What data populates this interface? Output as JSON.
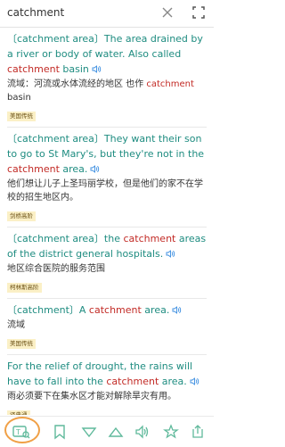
{
  "search": {
    "query": "catchment"
  },
  "entries": [
    {
      "en": [
        {
          "t": "〔catchment area〕The area drained by a river or body of water. Also called ",
          "k": false
        },
        {
          "t": "catchment",
          "k": true
        },
        {
          "t": " basin",
          "k": false
        }
      ],
      "zh": [
        {
          "t": "流域：河流或水体流经的地区 也作 ",
          "k": false
        },
        {
          "t": "catchment",
          "k": true
        },
        {
          "t": " basin",
          "k": false
        }
      ],
      "source": "美国传统"
    },
    {
      "en": [
        {
          "t": "〔catchment area〕They want their son to go to St Mary's, but they're not in the ",
          "k": false
        },
        {
          "t": "catchment",
          "k": true
        },
        {
          "t": " area.",
          "k": false
        }
      ],
      "zh": [
        {
          "t": "他们想让儿子上圣玛丽学校，但是他们的家不在学校的招生地区内。",
          "k": false
        }
      ],
      "source": "剑桥高阶"
    },
    {
      "en": [
        {
          "t": "〔catchment area〕the ",
          "k": false
        },
        {
          "t": "catchment",
          "k": true
        },
        {
          "t": " areas of the district general hospitals.",
          "k": false
        }
      ],
      "zh": [
        {
          "t": "地区综合医院的服务范围",
          "k": false
        }
      ],
      "source": "柯林斯高阶"
    },
    {
      "en": [
        {
          "t": "〔catchment〕A ",
          "k": false
        },
        {
          "t": "catchment",
          "k": true
        },
        {
          "t": " area.",
          "k": false
        }
      ],
      "zh": [
        {
          "t": "流域",
          "k": false
        }
      ],
      "source": "美国传统"
    },
    {
      "en": [
        {
          "t": "For the relief of drought, the rains will have to fall into the ",
          "k": false
        },
        {
          "t": "catchment",
          "k": true
        },
        {
          "t": " area.",
          "k": false
        }
      ],
      "zh": [
        {
          "t": "雨必须要下在集水区才能对解除旱灾有用。",
          "k": false
        }
      ],
      "source": "译典通"
    }
  ],
  "colors": {
    "english_text": "#1e8c80",
    "keyword": "#c22a25",
    "source_badge_bg": "#fbf0c6",
    "icon_green": "#5fb99b",
    "highlight_circle": "#f0a046"
  },
  "icons": {
    "clear": "close-icon",
    "menu": "grid-icon",
    "speaker": "speaker-icon",
    "bottom": [
      "translate-icon",
      "bookmark-icon",
      "triangle-down-icon",
      "triangle-up-icon",
      "audio-icon",
      "star-icon",
      "share-icon"
    ]
  }
}
